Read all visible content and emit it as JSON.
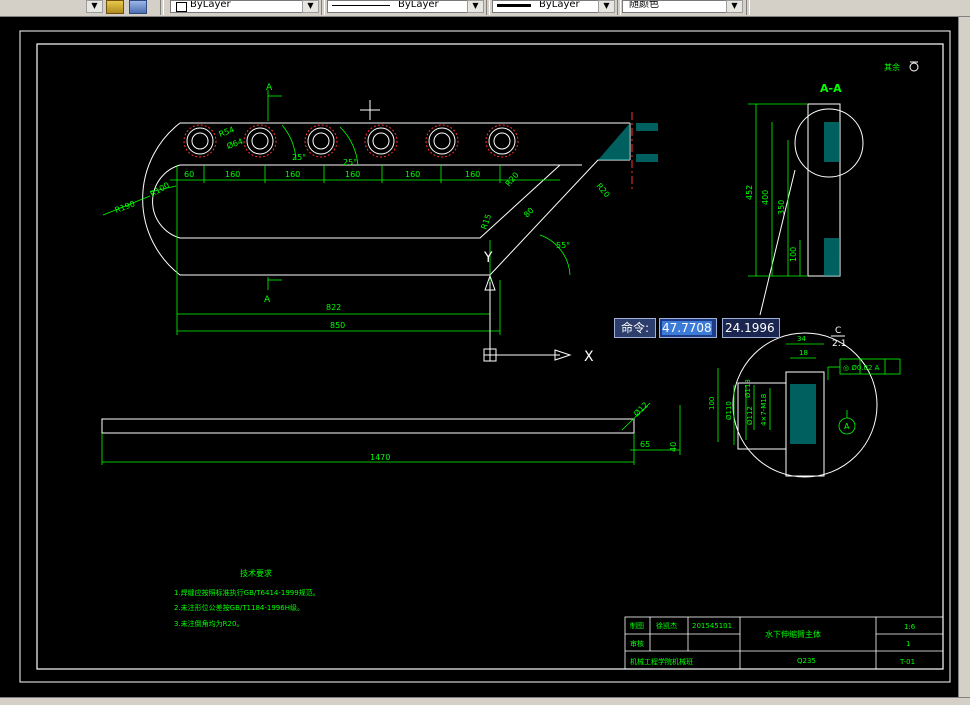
{
  "toolbar": {
    "layer_value": "ByLayer",
    "linetype_value": "ByLayer",
    "lineweight_value": "ByLayer",
    "color_value": "随颜色"
  },
  "dynamic_input": {
    "label": "命令:",
    "x_value": "47.7708",
    "y_value": "24.1996"
  },
  "ucs": {
    "x_axis_label": "X",
    "y_axis_label": "Y"
  },
  "drawing": {
    "section_label": "A-A",
    "section_mark": "A",
    "detail_label_top": "C",
    "detail_label_bottom": "2:1",
    "datum_label": "A",
    "corner_note": "其余",
    "front_dims": {
      "r_outer": "R190",
      "r_inner": "R100",
      "r54": "R54",
      "phi64": "Ø64",
      "a25a": "25°",
      "a25b": "25°",
      "seg_60": "60",
      "seg_160a": "160",
      "seg_160b": "160",
      "seg_160c": "160",
      "seg_160d": "160",
      "seg_160e": "160",
      "r20a": "R20",
      "r20b": "R20",
      "r15": "R15",
      "d80": "80",
      "a55": "55°",
      "len_822": "822",
      "len_850": "850"
    },
    "section_dims": {
      "h452": "452",
      "h400": "400",
      "h350": "350",
      "h100": "100"
    },
    "detail_dims": {
      "w34": "34",
      "w18": "18",
      "h100": "100",
      "phi110": "Ø110",
      "phi112": "Ø112",
      "phi113": "Ø113",
      "thread": "4×7-M18",
      "tolerance": "◎ Ø0.02 A"
    },
    "bar_dims": {
      "len_1470": "1470",
      "len_65": "65",
      "h40": "40",
      "phi12": "Ø12"
    }
  },
  "notes": {
    "title": "技术要求",
    "line1": "1.焊缝应按照标准执行GB/T6414-1999规范。",
    "line2": "2.未注形位公差按GB/T1184-1996H级。",
    "line3": "3.未注倒角均为R20。"
  },
  "title_block": {
    "r1_label": "制图",
    "r1_name": "徐凯杰",
    "r1_number": "201545101",
    "r2_label": "审核",
    "school": "机械工程学院机械班",
    "part_name": "水下伸缩臂主体",
    "material": "Q235",
    "scale": "1:6",
    "quantity": "1",
    "drawing_no": "T-01"
  }
}
